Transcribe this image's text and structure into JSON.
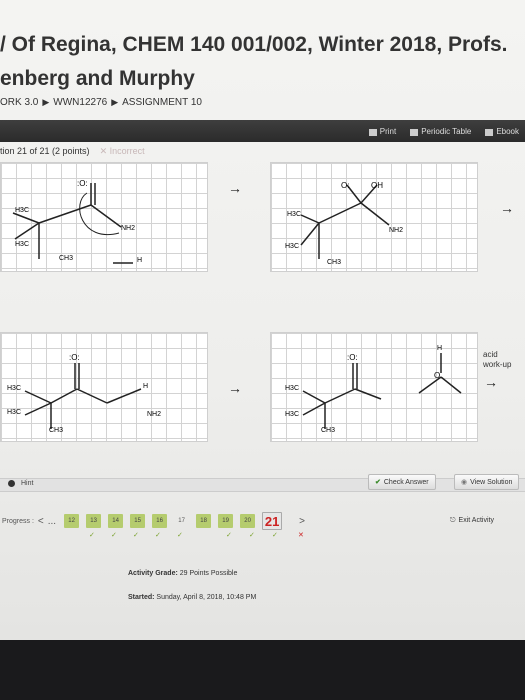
{
  "page": {
    "title_line1": "/ Of Regina, CHEM 140 001/002, Winter 2018, Profs.",
    "title_line2": "enberg and Murphy"
  },
  "breadcrumb": {
    "items": [
      "ORK 3.0",
      "WWN12276",
      "ASSIGNMENT 10"
    ],
    "separator": "▶"
  },
  "toolbar": {
    "print": "Print",
    "periodic_table": "Periodic Table",
    "ebook": "Ebook"
  },
  "question": {
    "label": "tion 21 of 21 (2 points)",
    "status": "Incorrect",
    "status_icon": "x-icon"
  },
  "diagrams": {
    "arrow": "→",
    "acid_workup_line1": "acid",
    "acid_workup_line2": "work-up",
    "panel1": {
      "h3c_top": "H3C",
      "h3c_bot": "H3C",
      "ch3": "CH3",
      "nh2": "NH2",
      "o": ":O:",
      "h": "H",
      "c": "C"
    },
    "panel2": {
      "o_minus": "O:",
      "oh": "OH",
      "h3c_top": "H3C",
      "h3c_bot": "H3C",
      "ch3": "CH3",
      "nh2": "NH2"
    },
    "panel3": {
      "o": ":O:",
      "h3c_top": "H3C",
      "h3c_bot": "H3C",
      "ch3": "CH3",
      "h": "H",
      "nh2": "NH2"
    },
    "panel4": {
      "o": ":O:",
      "h3c_top": "H3C",
      "h3c_bot": "H3C",
      "ch3": "CH3",
      "h": "H",
      "o2": "O"
    }
  },
  "actions": {
    "hint": "Hint",
    "check_answer": "Check Answer",
    "view_solution": "View Solution"
  },
  "progress": {
    "label": "Progress :",
    "prev": "<",
    "ellipsis": "...",
    "next": ">",
    "items": [
      {
        "n": "12",
        "state": "done"
      },
      {
        "n": "13",
        "state": "done"
      },
      {
        "n": "14",
        "state": "done"
      },
      {
        "n": "15",
        "state": "done"
      },
      {
        "n": "16",
        "state": "done"
      },
      {
        "n": "17",
        "state": "plain"
      },
      {
        "n": "18",
        "state": "done"
      },
      {
        "n": "19",
        "state": "done"
      },
      {
        "n": "20",
        "state": "done"
      },
      {
        "n": "21",
        "state": "current"
      }
    ],
    "exit": "Exit Activity"
  },
  "footer": {
    "grade_label": "Activity Grade:",
    "grade_value": "29 Points Possible",
    "started_label": "Started:",
    "started_value": "Sunday, April 8, 2018, 10:48 PM"
  },
  "colors": {
    "done": "#b5cc6e",
    "incorrect": "#cc2222",
    "check": "#3a8a2a"
  }
}
